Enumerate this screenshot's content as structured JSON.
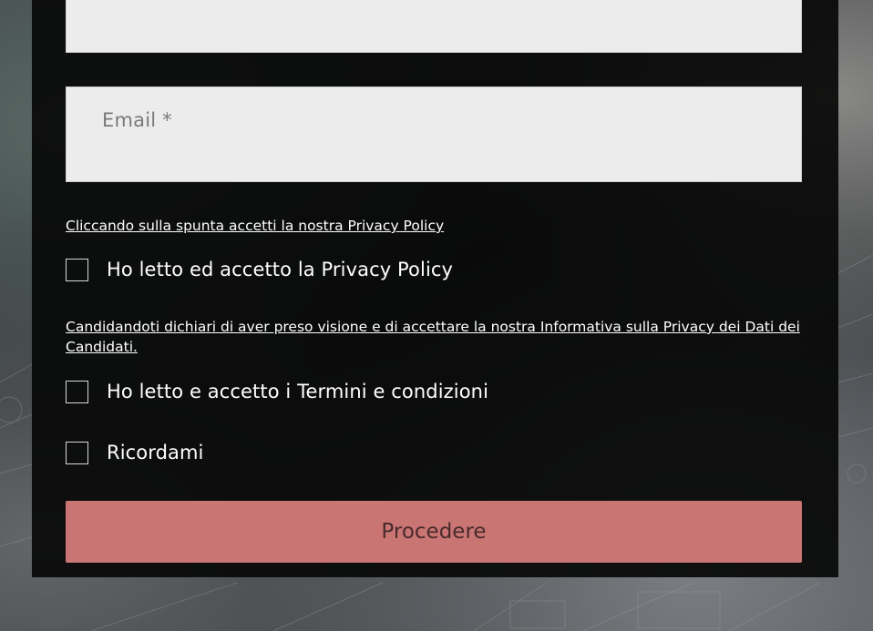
{
  "form": {
    "email_placeholder": "Email *",
    "privacy_note": "Cliccando sulla spunta accetti la nostra Privacy Policy",
    "privacy_checkbox_label": "Ho letto ed accetto la Privacy Policy",
    "candidate_note": "Candidandoti dichiari di aver preso visione e di accettare la nostra Informativa sulla Privacy dei Dati dei Candidati.",
    "terms_checkbox_label": "Ho letto e accetto i Termini e condizioni",
    "remember_checkbox_label": "Ricordami",
    "submit_label": "Procedere"
  },
  "colors": {
    "panel": "#080808",
    "field": "#ececec",
    "submit": "#c97574"
  }
}
